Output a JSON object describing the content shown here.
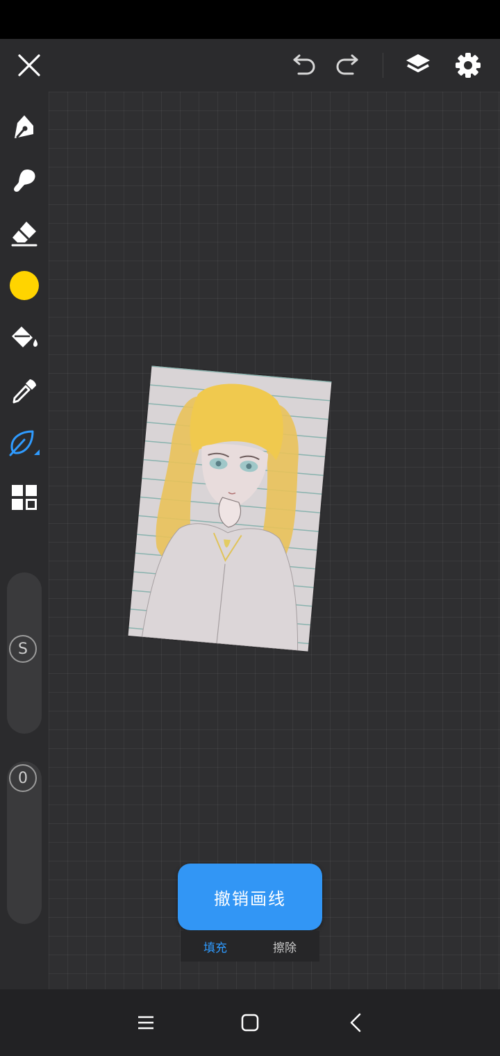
{
  "toolbar": {
    "icons": [
      "close-icon",
      "undo-icon",
      "redo-icon",
      "layers-icon",
      "settings-icon"
    ]
  },
  "tools": {
    "items": [
      "pen-icon",
      "smudge-brush-icon",
      "eraser-icon",
      "color-swatch",
      "paint-bucket-icon",
      "eyedropper-icon",
      "leaf-brush-icon",
      "grid-tools-icon"
    ],
    "current_color": "#ffd400",
    "selected_tool_color": "#2f9bff"
  },
  "sliders": {
    "size_label": "S",
    "opacity_label": "0"
  },
  "popup": {
    "fill_label": "填充",
    "erase_label": "擦除",
    "fill_color": "#2f9bff",
    "erase_color": "#c8c8c8"
  },
  "undo_stroke": {
    "label": "撤销画线",
    "color": "#3296f5"
  },
  "navbar": {
    "icons": [
      "menu-icon",
      "home-icon",
      "back-icon"
    ]
  }
}
